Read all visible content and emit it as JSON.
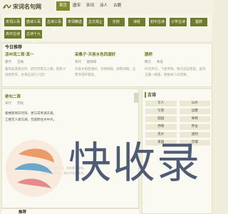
{
  "header": {
    "site_name": "宋词名句网",
    "nav": [
      "首页",
      "唐宋",
      "宋词",
      "诗人",
      "古籍"
    ]
  },
  "categories": {
    "row1": [
      "宋词三百首",
      "唐诗三百首",
      "古诗三百首",
      "宋词精选",
      "古文观止",
      "乐府",
      "诗经",
      "初中古诗",
      "小学古诗",
      "楚辞"
    ],
    "row2": [
      "高中古诗",
      "古诗十九首"
    ]
  },
  "today": {
    "heading": "今日推荐",
    "poems": [
      {
        "title": "凉州词二首·其一",
        "dynasty": "唐代",
        "author": "王翰",
        "body": "葡萄美酒夜光杯，欲饮琵琶马上催。醉卧沙场君莫笑，古来征战几人回？"
      },
      {
        "title": "采桑子·天容水色西湖好",
        "dynasty": "宋代",
        "author": "欧阳修",
        "body": "天容水色西湖好，云物俱鲜。鸥鹭闲眠，应惯寻常听管弦。"
      },
      {
        "title": "鹊桥",
        "dynasty": "两汉",
        "author": "佚名",
        "body": "纤云弄巧，飞星传恨，银汉迢迢暗度。金风玉露一相逢，便胜却人间无数。"
      }
    ]
  },
  "main_poem": {
    "title": "绝句二首",
    "dynasty": "宋代",
    "author": "苏轼",
    "lines": [
      "秦楼新晴日月阳，更与常青满天香。",
      "江楼无人雨马湖，空留鹤住水中声。"
    ],
    "faded": [
      "已酉年九月初三日，苏轼题于翠微。",
      "闲居无事日月长，独坐书斋品茶香。"
    ]
  },
  "bottom": {
    "heading": "推荐"
  },
  "sidebar": {
    "heading": "古诗",
    "items": [
      "写人",
      "山水",
      "写景",
      "边塞",
      "田园",
      "咏物",
      "抒情",
      "怀古",
      "思乡",
      "送别",
      "爱国",
      "哲理"
    ]
  },
  "watermark": {
    "text": "快收录"
  }
}
